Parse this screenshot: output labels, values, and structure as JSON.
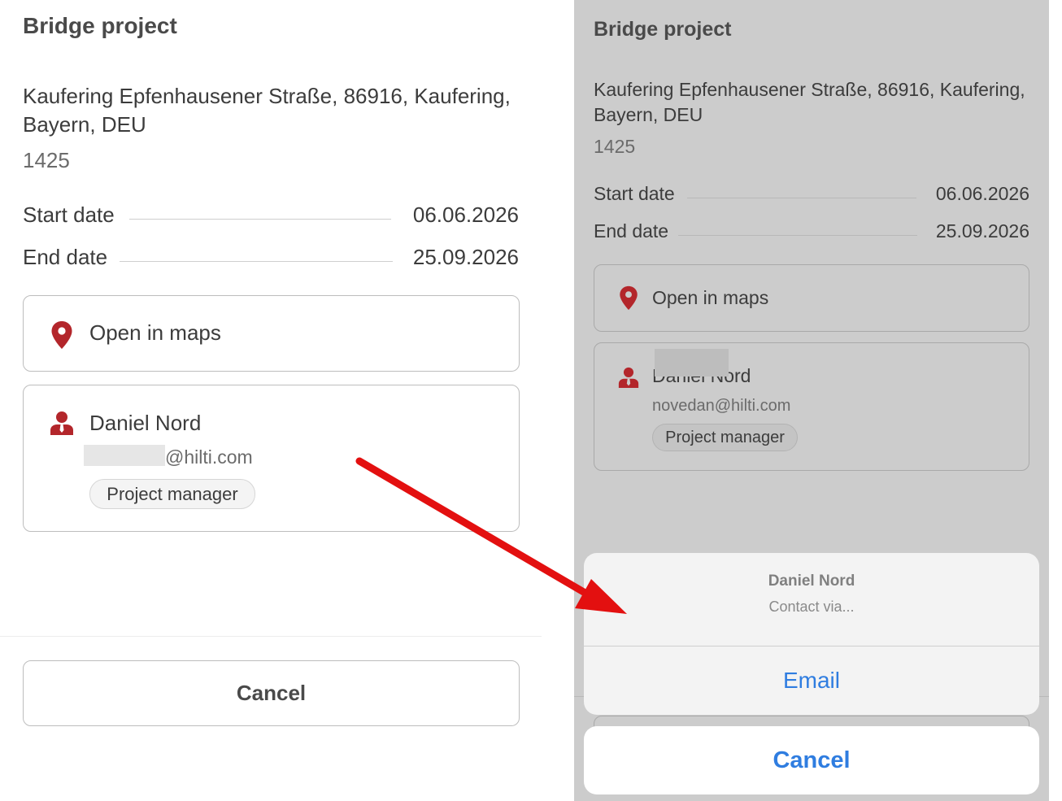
{
  "left": {
    "project_title": "Bridge project",
    "address": "Kaufering Epfenhausener Straße, 86916, Kaufering, Bayern, DEU",
    "project_number": "1425",
    "start_label": "Start date",
    "start_value": "06.06.2026",
    "end_label": "End date",
    "end_value": "25.09.2026",
    "open_maps_label": "Open in maps",
    "contact_name": "Daniel Nord",
    "contact_email_suffix": "@hilti.com",
    "contact_role": "Project manager",
    "cancel_label": "Cancel"
  },
  "right": {
    "project_title": "Bridge project",
    "address": "Kaufering Epfenhausener Straße, 86916, Kaufering, Bayern, DEU",
    "project_number": "1425",
    "start_label": "Start date",
    "start_value": "06.06.2026",
    "end_label": "End date",
    "end_value": "25.09.2026",
    "open_maps_label": "Open in maps",
    "contact_name_partial": "Daniel Nord",
    "contact_email": "novedan@hilti.com",
    "contact_role": "Project manager",
    "sheet": {
      "title": "Daniel Nord",
      "subtitle": "Contact via...",
      "option_email": "Email",
      "cancel_label": "Cancel"
    }
  },
  "colors": {
    "accent_red": "#b3262b",
    "ios_blue": "#2f7de0",
    "annotation_arrow": "#e31010"
  },
  "icons": {
    "map_pin": "map-pin-icon",
    "person": "person-icon"
  }
}
